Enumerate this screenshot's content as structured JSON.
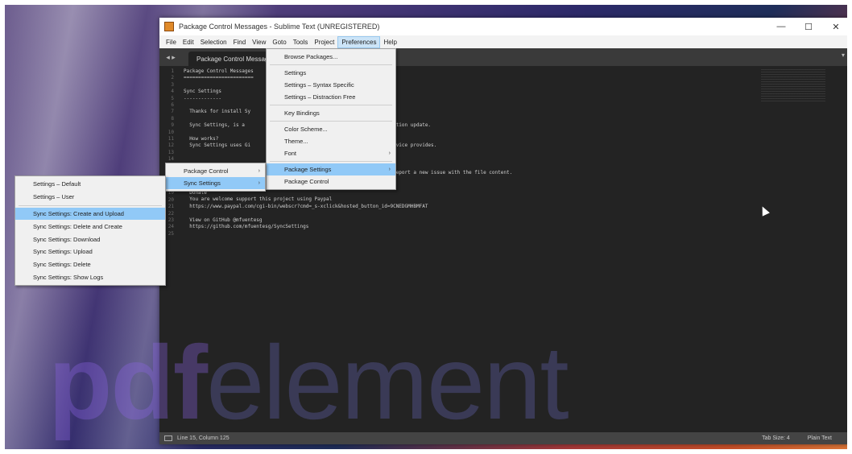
{
  "window": {
    "title": "Package Control Messages - Sublime Text (UNREGISTERED)",
    "controls": {
      "minimize": "—",
      "maximize": "☐",
      "close": "✕"
    }
  },
  "menubar": {
    "items": [
      "File",
      "Edit",
      "Selection",
      "Find",
      "View",
      "Goto",
      "Tools",
      "Project",
      "Preferences",
      "Help"
    ],
    "active": "Preferences"
  },
  "tabs": {
    "nav": "◂ ▸",
    "active_tab": "Package Control Messag",
    "dropdown": "▾"
  },
  "editor": {
    "line_numbers": [
      "1",
      "2",
      "3",
      "4",
      "5",
      "6",
      "7",
      "8",
      "9",
      "10",
      "11",
      "12",
      "13",
      "14",
      "15",
      "16",
      "17",
      "18",
      "19",
      "20",
      "21",
      "22",
      "23",
      "24",
      "25"
    ],
    "lines": [
      "Package Control Messages",
      "========================",
      "",
      "Sync Settings",
      "-------------",
      "",
      "  Thanks for install Sy",
      "",
      "  Sync Settings, is a                                  one text configuration update.",
      "",
      "  How works?",
      "  Sync Settings uses Gi                                ures that this service provides.",
      "",
      "",
      "",
      "                                                       ngs\" command and report a new issue with the file content.",
      "",
      "",
      "  Donate",
      "  You are welcome support this project using Paypal",
      "  https://www.paypal.com/cgi-bin/webscr?cmd=_s-xclick&hosted_button_id=9CNEDGMHBMFAT",
      "",
      "  View on GitHub @mfuentesg",
      "  https://github.com/mfuentesg/SyncSettings",
      ""
    ]
  },
  "preferences_menu": {
    "items": [
      {
        "label": "Browse Packages...",
        "arrow": "",
        "sep_after": true,
        "highlight": false
      },
      {
        "label": "Settings",
        "arrow": "",
        "sep_after": false,
        "highlight": false
      },
      {
        "label": "Settings – Syntax Specific",
        "arrow": "",
        "sep_after": false,
        "highlight": false
      },
      {
        "label": "Settings – Distraction Free",
        "arrow": "",
        "sep_after": true,
        "highlight": false
      },
      {
        "label": "Key Bindings",
        "arrow": "",
        "sep_after": true,
        "highlight": false
      },
      {
        "label": "Color Scheme...",
        "arrow": "",
        "sep_after": false,
        "highlight": false
      },
      {
        "label": "Theme...",
        "arrow": "",
        "sep_after": false,
        "highlight": false
      },
      {
        "label": "Font",
        "arrow": "›",
        "sep_after": true,
        "highlight": false
      },
      {
        "label": "Package Settings",
        "arrow": "›",
        "sep_after": false,
        "highlight": true
      },
      {
        "label": "Package Control",
        "arrow": "",
        "sep_after": false,
        "highlight": false
      }
    ]
  },
  "package_settings_menu": {
    "items": [
      {
        "label": "Package Control",
        "arrow": "›",
        "highlight": false
      },
      {
        "label": "Sync Settings",
        "arrow": "›",
        "highlight": true
      }
    ]
  },
  "sync_settings_menu": {
    "items": [
      {
        "label": "Settings – Default",
        "sep_after": false,
        "highlight": false
      },
      {
        "label": "Settings – User",
        "sep_after": true,
        "highlight": false
      },
      {
        "label": "Sync Settings: Create and Upload",
        "sep_after": false,
        "highlight": true
      },
      {
        "label": "Sync Settings: Delete and Create",
        "sep_after": false,
        "highlight": false
      },
      {
        "label": "Sync Settings: Download",
        "sep_after": false,
        "highlight": false
      },
      {
        "label": "Sync Settings: Upload",
        "sep_after": false,
        "highlight": false
      },
      {
        "label": "Sync Settings: Delete",
        "sep_after": false,
        "highlight": false
      },
      {
        "label": "Sync Settings: Show Logs",
        "sep_after": false,
        "highlight": false
      }
    ]
  },
  "statusbar": {
    "left": "Line 15, Column 125",
    "tab_size": "Tab Size: 4",
    "syntax": "Plain Text"
  },
  "watermark": {
    "bold": "pdf",
    "regular": "element"
  }
}
